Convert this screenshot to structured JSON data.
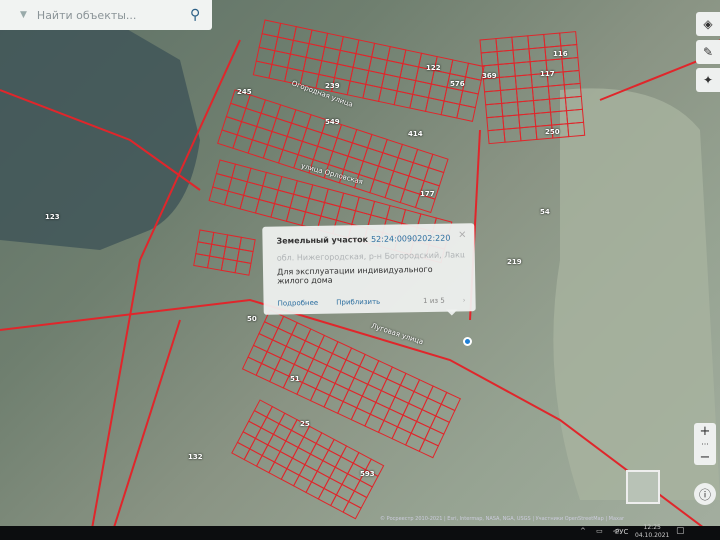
{
  "search": {
    "placeholder": "Найти объекты...",
    "search_icon": "search-icon"
  },
  "controls": {
    "layers_icon": "layers-icon",
    "edit_icon": "pencil-icon",
    "tools_icon": "sparkle-icon",
    "zoom_in": "+",
    "zoom_dots": "···",
    "zoom_out": "−",
    "info_icon": "info-icon"
  },
  "popup": {
    "type_label": "Земельный участок",
    "cadastral_number": "52:24:0090202:220",
    "address": "обл. Нижегородская, р-н Богородский, Лакшинская",
    "permitted_use": "Для эксплуатации индивидуального жилого дома",
    "more_link": "Подробнее",
    "zoom_link": "Приблизить",
    "pagination": "1 из 5",
    "next_icon": "›",
    "close_icon": "×"
  },
  "map": {
    "parcel_color": "#e0262b",
    "labels": [
      "123",
      "132",
      "219",
      "54",
      "51",
      "50",
      "239",
      "549",
      "414",
      "576",
      "369",
      "117",
      "116",
      "245",
      "593",
      "122",
      "177",
      "250",
      "25"
    ],
    "street_labels": [
      "Огородная улица",
      "улица Орловская",
      "Луговая улица"
    ]
  },
  "attribution": "© Росреестр 2010-2021 | Esri, Intermap, NASA, NGA, USGS | Участники OpenStreetMap | Maxar",
  "taskbar": {
    "language": "РУС",
    "time": "12:25",
    "date": "04.10.2021",
    "tray_icons": "^ ▭ ◁",
    "notification_icon": "▢"
  }
}
